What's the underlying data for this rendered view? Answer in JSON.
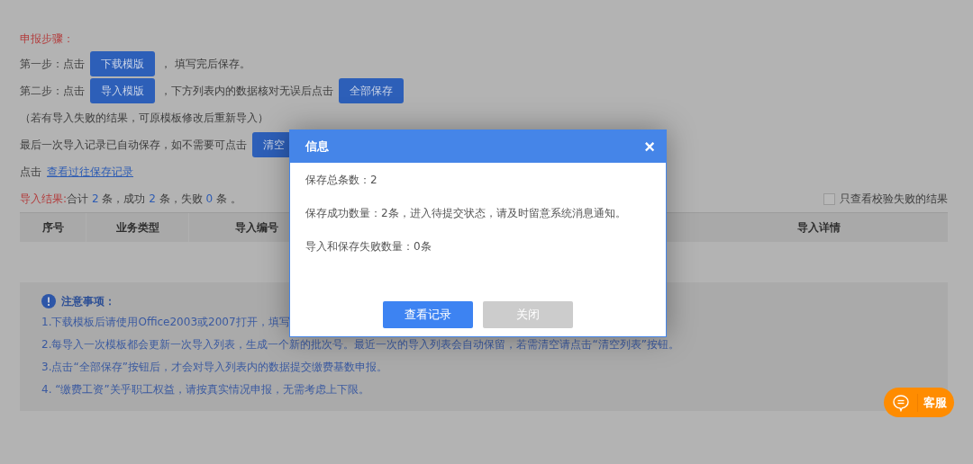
{
  "steps_title": "申报步骤：",
  "steps": [
    [
      {
        "kind": "text",
        "text": "第一步：点击"
      },
      {
        "kind": "button",
        "text": "下载模版"
      },
      {
        "kind": "text",
        "text": "，  填写完后保存。"
      }
    ],
    [
      {
        "kind": "text",
        "text": "第二步：点击"
      },
      {
        "kind": "button",
        "text": "导入模版"
      },
      {
        "kind": "text",
        "text": "，下方列表内的数据核对无误后点击"
      },
      {
        "kind": "button",
        "text": "全部保存"
      }
    ],
    [
      {
        "kind": "text",
        "text": "（若有导入失败的结果，可原模板修改后重新导入）"
      }
    ],
    [
      {
        "kind": "text",
        "text": "最后一次导入记录已自动保存，如不需要可点击"
      },
      {
        "kind": "button",
        "text": "清空"
      }
    ],
    [
      {
        "kind": "text",
        "text": "点击"
      },
      {
        "kind": "link",
        "text": "查看过往保存记录"
      }
    ]
  ],
  "result": {
    "label": "导入结果:",
    "parts": [
      {
        "kind": "text",
        "text": "合计 "
      },
      {
        "kind": "count",
        "text": "2"
      },
      {
        "kind": "text",
        "text": " 条，成功 "
      },
      {
        "kind": "count",
        "text": "2"
      },
      {
        "kind": "text",
        "text": " 条，失败 "
      },
      {
        "kind": "count",
        "text": "0"
      },
      {
        "kind": "text",
        "text": " 条 。"
      }
    ]
  },
  "filter": {
    "label": "只查看校验失败的结果",
    "checked": false
  },
  "table": {
    "columns": [
      "序号",
      "业务类型",
      "导入编号",
      "导入详情"
    ]
  },
  "notes": {
    "title": "注意事项：",
    "items": [
      "1.下载模板后请使用Office2003或2007打开，填写",
      "2.每导入一次模板都会更新一次导入列表，生成一个新的批次号。最近一次的导入列表会自动保留，若需清空请点击“清空列表”按钮。",
      "3.点击“全部保存”按钮后，才会对导入列表内的数据提交缴费基数申报。",
      "4.  “缴费工资”关乎职工权益，请按真实情况申报，无需考虑上下限。"
    ]
  },
  "dialog": {
    "title": "信息",
    "close": "×",
    "lines": [
      "保存总条数：2",
      "保存成功数量：2条，进入待提交状态，请及时留意系统消息通知。",
      "导入和保存失败数量：0条"
    ],
    "buttons": [
      {
        "kind": "primary",
        "text": "查看记录"
      },
      {
        "kind": "secondary",
        "text": "关闭"
      }
    ]
  },
  "service": {
    "label": "客服"
  }
}
